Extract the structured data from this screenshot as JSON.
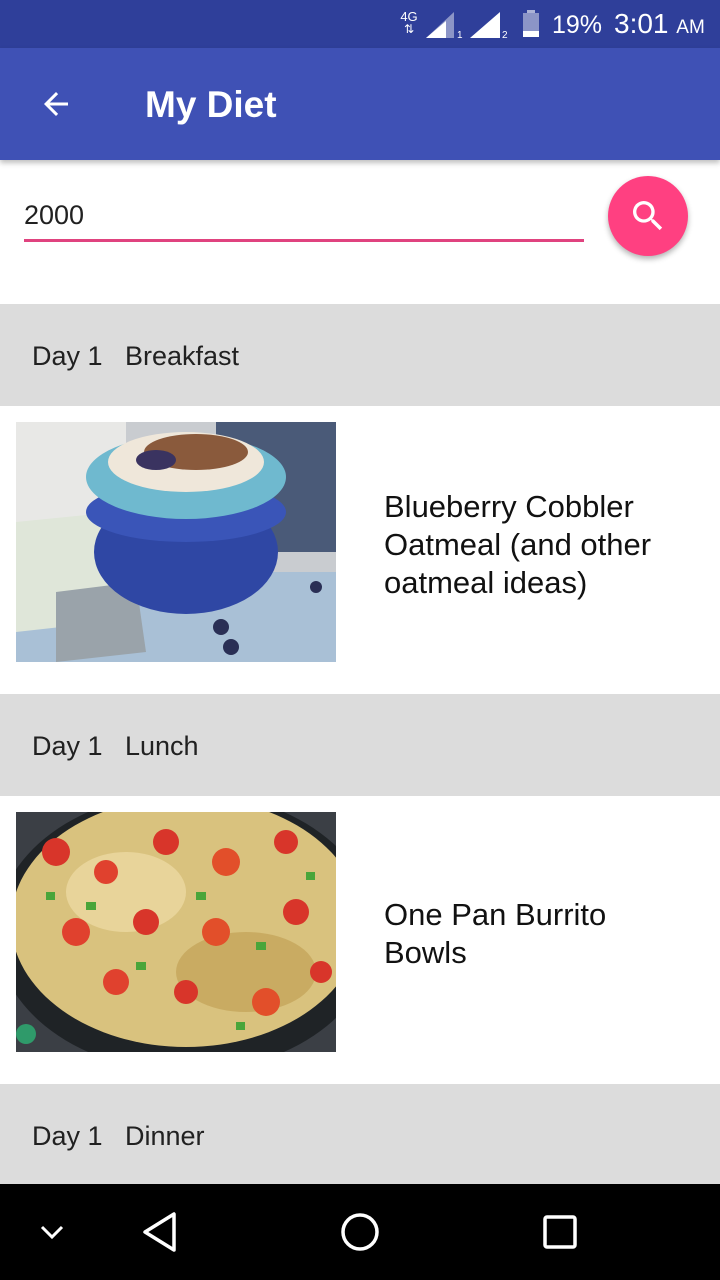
{
  "status_bar": {
    "network_type": "4G",
    "network_arrows": "⇅",
    "sim1_label": "1",
    "sim2_label": "2",
    "battery_percent": "19%",
    "time": "3:01",
    "ampm": "AM"
  },
  "app_bar": {
    "title": "My Diet",
    "back_icon": "arrow-back-icon"
  },
  "search": {
    "value": "2000",
    "button_icon": "search-icon"
  },
  "sections": [
    {
      "day": "Day 1",
      "meal": "Breakfast",
      "recipe": {
        "title": "Blueberry Cobbler Oatmeal (and other oatmeal ideas)",
        "image": "oatmeal-bowl-photo"
      }
    },
    {
      "day": "Day 1",
      "meal": "Lunch",
      "recipe": {
        "title": "One Pan Burrito Bowls",
        "image": "burrito-bowl-pan-photo"
      }
    },
    {
      "day": "Day 1",
      "meal": "Dinner"
    }
  ],
  "nav_bar": {
    "items": [
      "chevron-down-icon",
      "back-triangle-icon",
      "home-circle-icon",
      "recents-square-icon"
    ]
  },
  "colors": {
    "status_bar": "#2f3f9a",
    "app_bar": "#3f51b5",
    "accent": "#ff4081",
    "input_underline": "#e0437f",
    "section_header": "#dcdcdc"
  }
}
